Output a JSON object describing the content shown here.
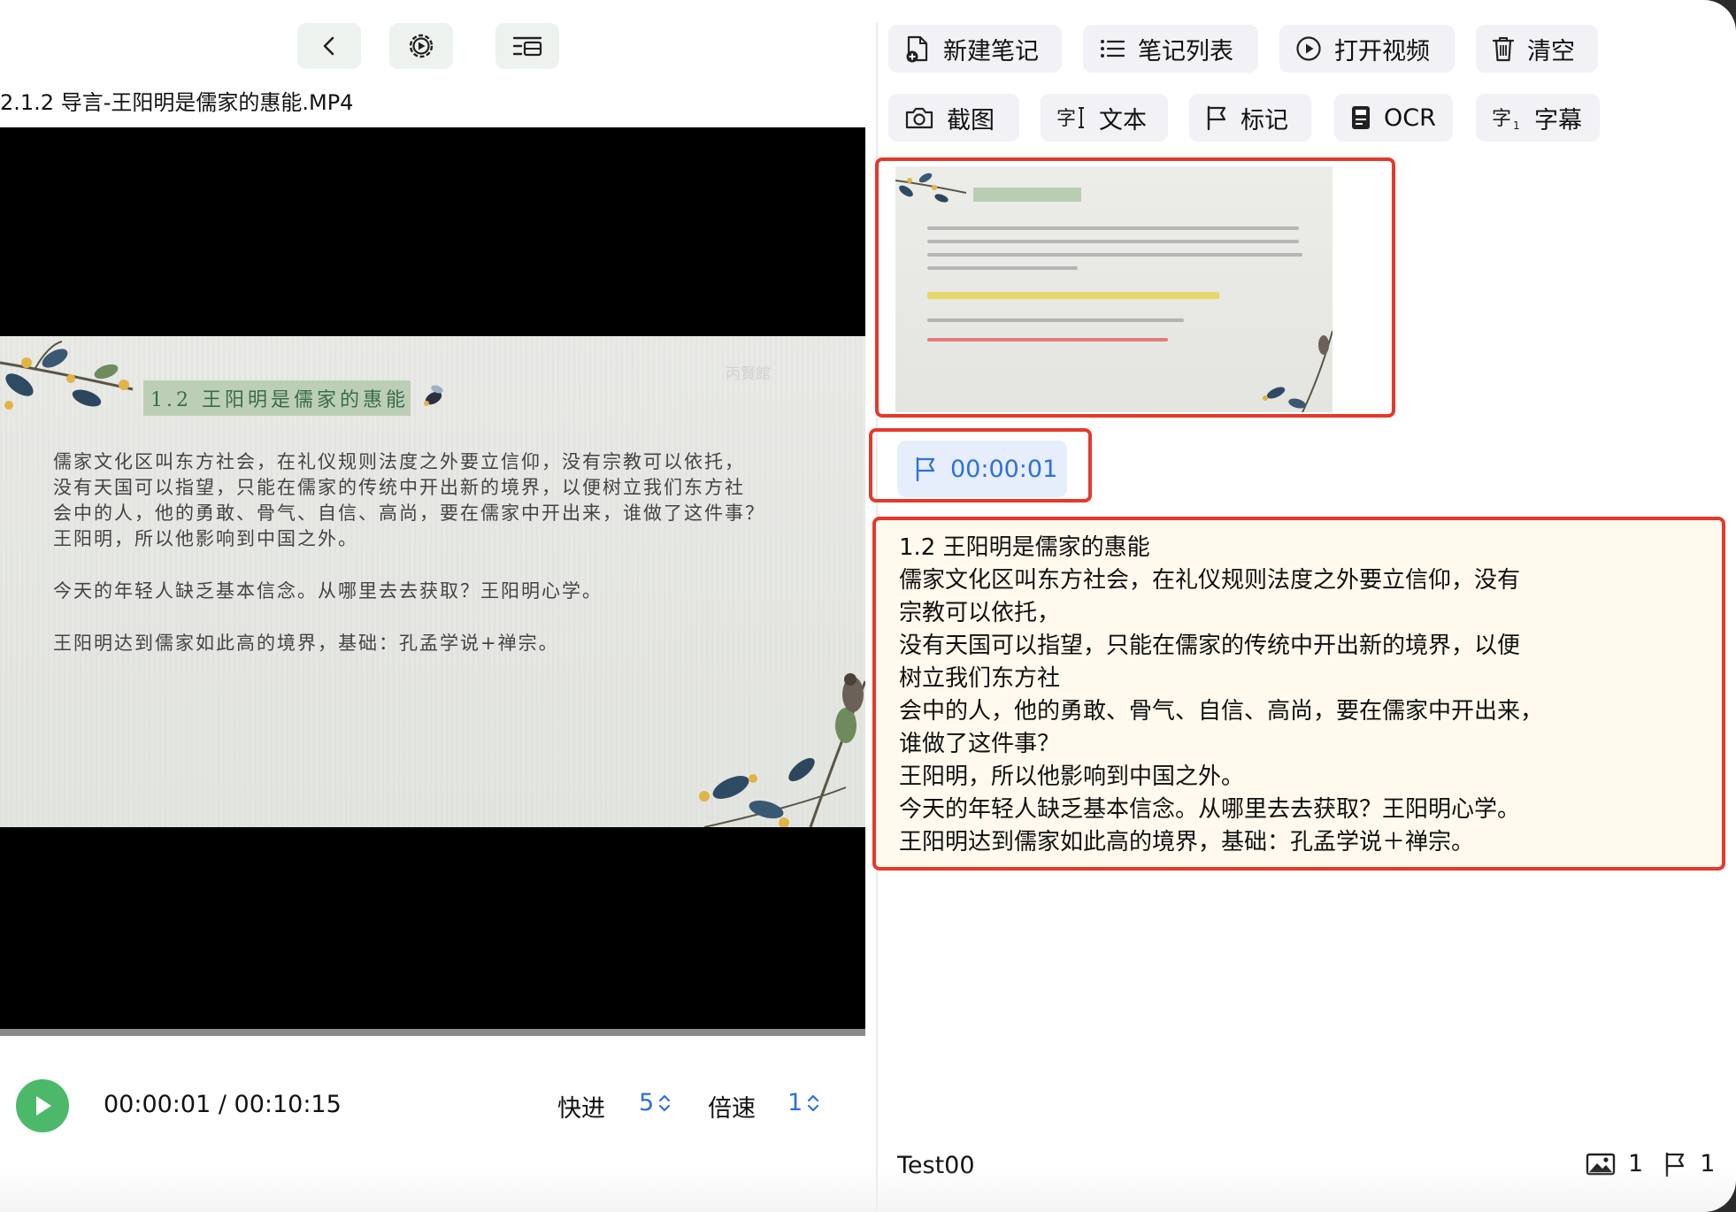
{
  "player": {
    "file_title": "2.1.2 导言-王阳明是儒家的惠能.MP4",
    "top_buttons": [
      "back-icon",
      "settings-icon",
      "playlist-icon"
    ],
    "time_display": "00:00:01 / 00:10:15",
    "fast_forward_label": "快进",
    "fast_forward_value": "5",
    "speed_label": "倍速",
    "speed_value": "1"
  },
  "slide": {
    "title": "1.2 王阳明是儒家的惠能",
    "watermark": "丙賢館",
    "lines": [
      "儒家文化区叫东方社会，在礼仪规则法度之外要立信仰，没有宗教可以依托，",
      "没有天国可以指望，只能在儒家的传统中开出新的境界，以便树立我们东方社",
      "会中的人，他的勇敢、骨气、自信、高尚，要在儒家中开出来，谁做了这件事？",
      "王阳明，所以他影响到中国之外。",
      "今天的年轻人缺乏基本信念。从哪里去去获取？王阳明心学。",
      "王阳明达到儒家如此高的境界，基础：孔孟学说+禅宗。"
    ]
  },
  "toolbar": {
    "row1": [
      {
        "label": "新建笔记",
        "icon": "new-note-icon"
      },
      {
        "label": "笔记列表",
        "icon": "list-icon"
      },
      {
        "label": "打开视频",
        "icon": "play-circle-icon"
      },
      {
        "label": "清空",
        "icon": "trash-icon"
      }
    ],
    "row2": [
      {
        "label": "截图",
        "icon": "camera-icon"
      },
      {
        "label": "文本",
        "icon": "text-cursor-icon"
      },
      {
        "label": "标记",
        "icon": "flag-icon"
      },
      {
        "label": "OCR",
        "icon": "ocr-icon"
      },
      {
        "label": "字幕",
        "icon": "subtitle-icon"
      }
    ]
  },
  "notes": {
    "mark_time": "00:00:01",
    "text_lines": [
      "1.2 王阳明是儒家的惠能",
      "儒家文化区叫东方社会，在礼仪规则法度之外要立信仰，没有",
      "宗教可以依托，",
      "没有天国可以指望，只能在儒家的传统中开出新的境界，以便",
      "树立我们东方社",
      "会中的人，他的勇敢、骨气、自信、高尚，要在儒家中开出来，",
      "谁做了这件事？",
      "王阳明，所以他影响到中国之外。",
      "今天的年轻人缺乏基本信念。从哪里去去获取？王阳明心学。",
      "王阳明达到儒家如此高的境界，基础：孔孟学说＋禅宗。"
    ]
  },
  "footer": {
    "user": "Test00",
    "image_count": "1",
    "mark_count": "1"
  },
  "colors": {
    "accent_blue": "#2f6fe0",
    "play_green": "#4cb96a",
    "highlight_red": "#e5392c",
    "note_bg": "#fffaed"
  }
}
